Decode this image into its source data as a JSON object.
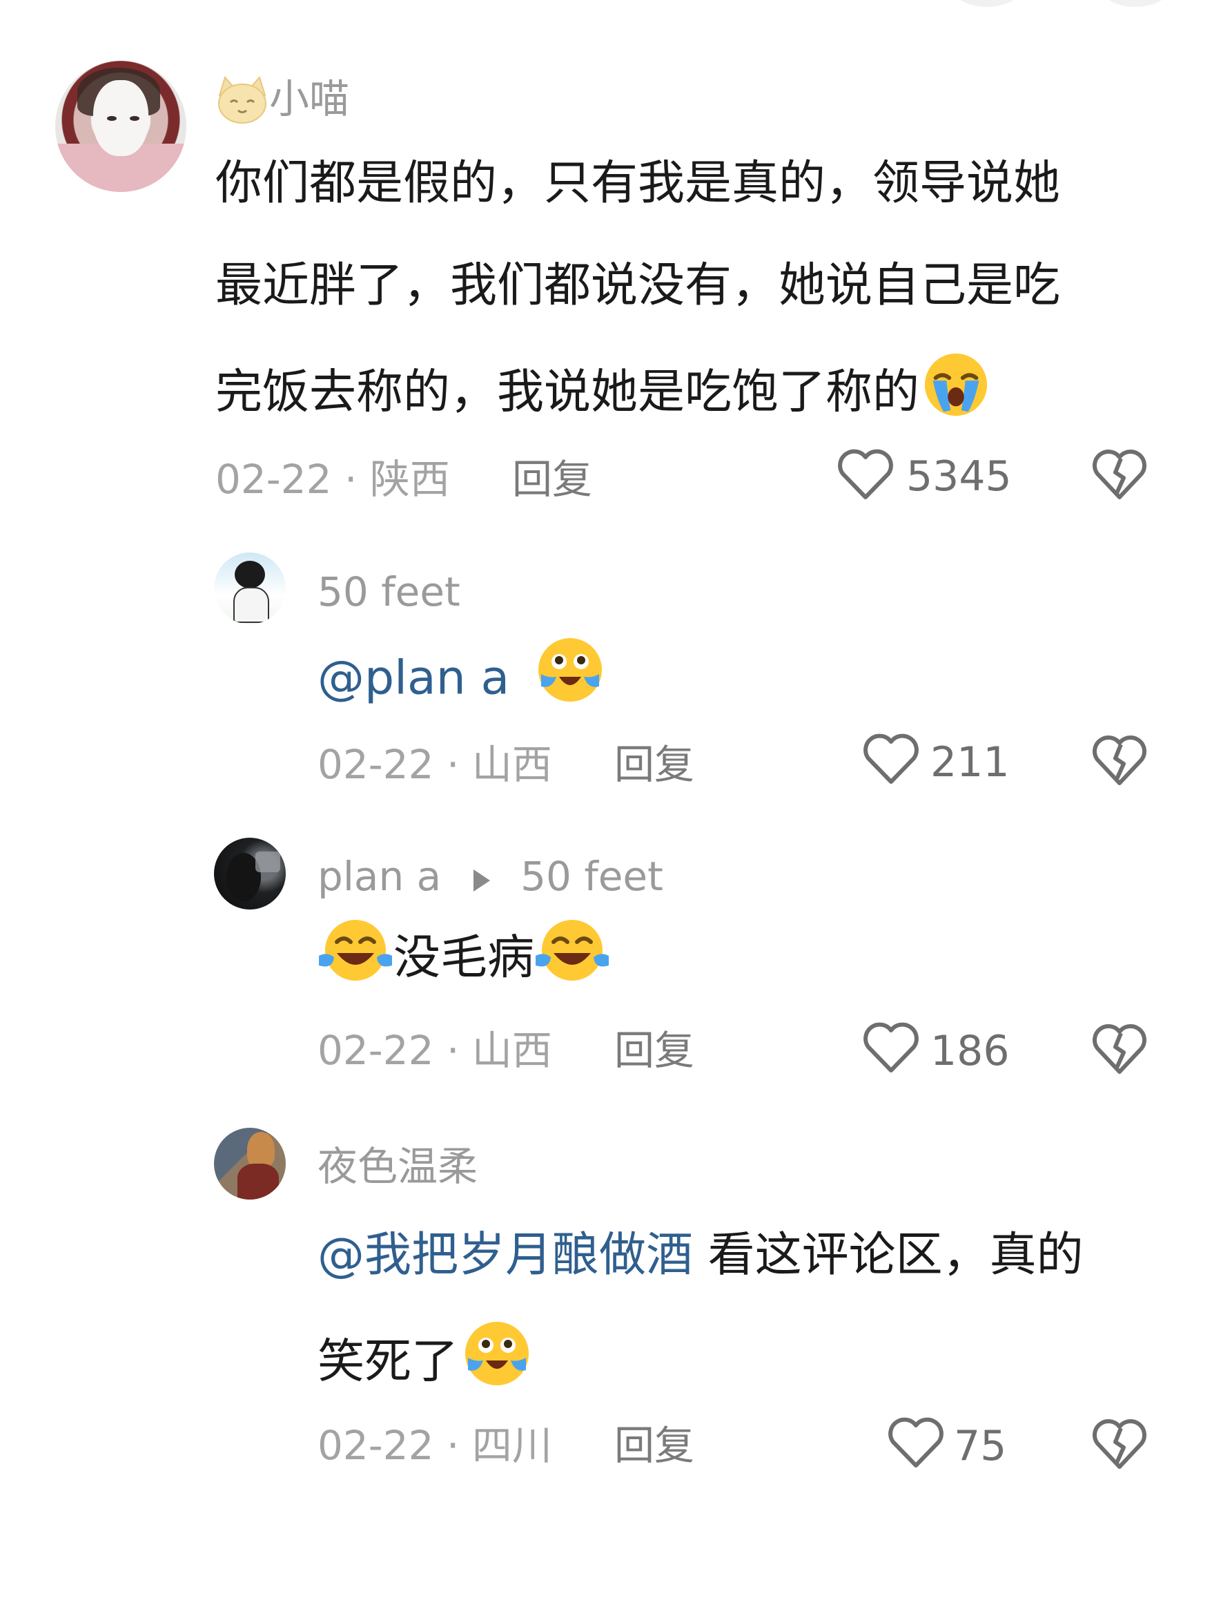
{
  "comments": [
    {
      "username": "小喵",
      "avatar_icon": "user-avatar",
      "badge_icon": "cat-emoji-icon",
      "lines": [
        "你们都是假的，只有我是真的，领导说她",
        "最近胖了，我们都说没有，她说自己是吃",
        "完饭去称的，我说她是吃饱了称的"
      ],
      "line3_emoji": "loudly-crying-emoji-icon",
      "date": "02-22",
      "location": "陕西",
      "meta": "02-22 · 陕西",
      "reply_label": "回复",
      "likes": "5345"
    },
    {
      "username": "50 feet",
      "mention": "@plan a",
      "emoji": "crying-face-emoji-icon",
      "date": "02-22",
      "location": "山西",
      "meta": "02-22 · 山西",
      "reply_label": "回复",
      "likes": "211"
    },
    {
      "username": "plan a",
      "reply_to": "50 feet",
      "text": "没毛病",
      "emoji": "tears-of-joy-emoji-icon",
      "date": "02-22",
      "location": "山西",
      "meta": "02-22 · 山西",
      "reply_label": "回复",
      "likes": "186"
    },
    {
      "username": "夜色温柔",
      "mention": "@我把岁月酿做酒",
      "text_line1": " 看这评论区，真的",
      "text_line2": "笑死了",
      "emoji": "crying-face-emoji-icon",
      "date": "02-22",
      "location": "四川",
      "meta": "02-22 · 四川",
      "reply_label": "回复",
      "likes": "75"
    }
  ],
  "colors": {
    "text": "#1a1a1a",
    "meta": "#a3a3a3",
    "mention": "#2f5f8f",
    "icon": "#6e6e6e"
  }
}
